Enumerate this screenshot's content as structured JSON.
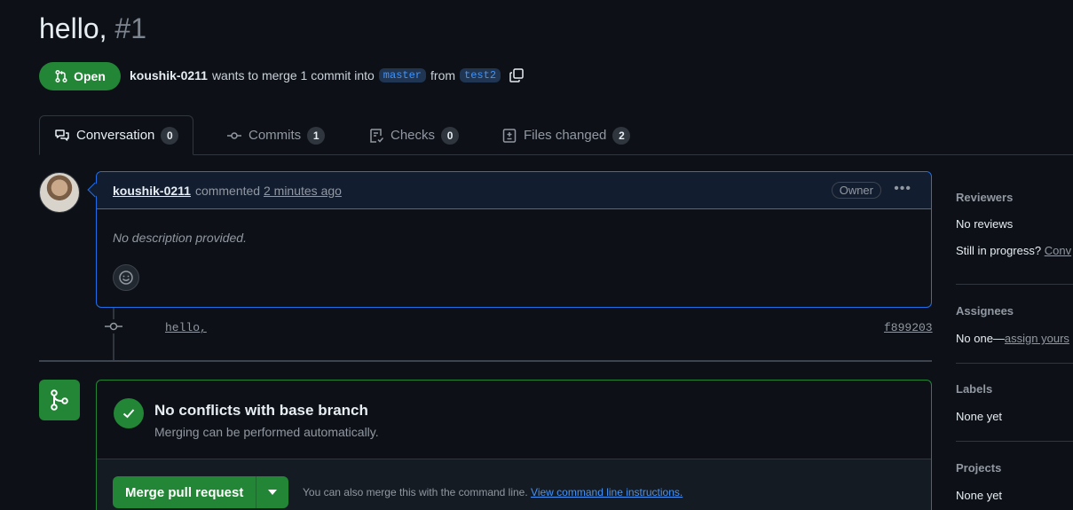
{
  "pr": {
    "title": "hello,",
    "number": "#1",
    "state": "Open",
    "author": "koushik-0211",
    "merge_text_1": "wants to merge 1 commit into",
    "base_branch": "master",
    "merge_text_2": "from",
    "head_branch": "test2"
  },
  "tabs": [
    {
      "label": "Conversation",
      "count": "0"
    },
    {
      "label": "Commits",
      "count": "1"
    },
    {
      "label": "Checks",
      "count": "0"
    },
    {
      "label": "Files changed",
      "count": "2"
    }
  ],
  "comment": {
    "author": "koushik-0211",
    "action": "commented",
    "time": "2 minutes ago",
    "role": "Owner",
    "body": "No description provided."
  },
  "commit": {
    "message": "hello,",
    "sha": "f899203"
  },
  "merge": {
    "title": "No conflicts with base branch",
    "subtitle": "Merging can be performed automatically.",
    "button": "Merge pull request",
    "hint": "You can also merge this with the command line.",
    "hint_link": "View command line instructions."
  },
  "sidebar": {
    "reviewers": {
      "heading": "Reviewers",
      "value": "No reviews",
      "progress_prefix": "Still in progress?",
      "progress_link": "Conv"
    },
    "assignees": {
      "heading": "Assignees",
      "value_prefix": "No one—",
      "value_link": "assign yours"
    },
    "labels": {
      "heading": "Labels",
      "value": "None yet"
    },
    "projects": {
      "heading": "Projects",
      "value": "None yet"
    }
  },
  "colors": {
    "background": "#0d1117",
    "open_green": "#238636",
    "link_blue": "#4493f8",
    "comment_border": "#1f6feb"
  }
}
